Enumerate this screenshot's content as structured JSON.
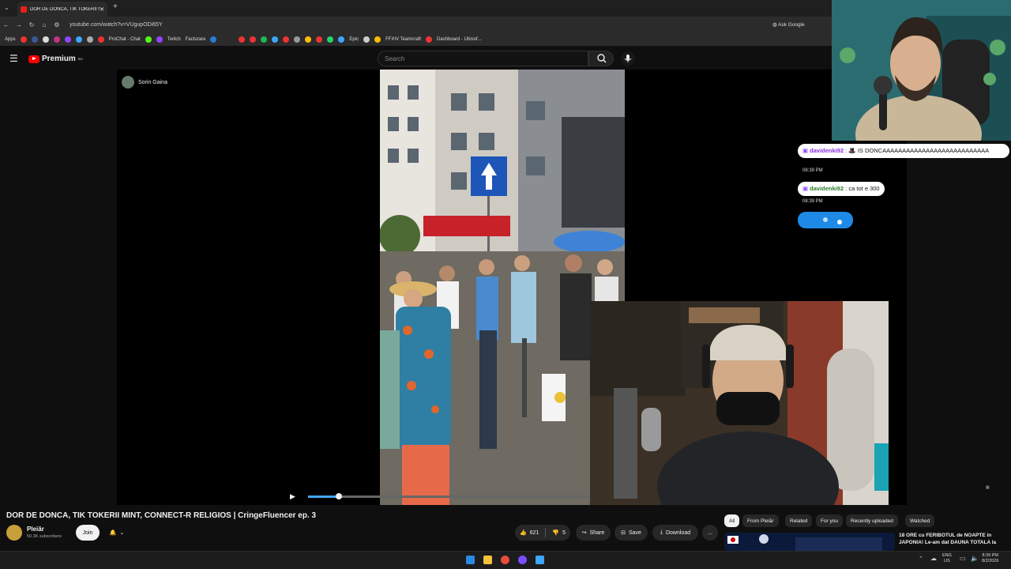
{
  "browser": {
    "tab_title": "DOR DE DONCA, TIK TOKERII M...",
    "url": "youtube.com/watch?v=VUgupODi65Y",
    "ask_google": "Ask Google",
    "bookmarks": [
      "Apps",
      "ProChat - Chat",
      "Twitch",
      "Facturare",
      "Epic",
      "FFXIV Teamcraft",
      "Dashboard - Ubisof..."
    ]
  },
  "youtube": {
    "logo_text": "Premium",
    "logo_badge": "RO",
    "search_placeholder": "Search",
    "video_overlay_channel": "Sorin Gaina",
    "video_title": "DOR DE DONCA, TIK TOKERII MINT, CONNECT-R RELIGIOS | CringeFluencer ep. 3",
    "channel_name": "Pleiăr",
    "subscribers": "50.3K subscribers",
    "join_label": "Join",
    "likes": "621",
    "dislikes": "5",
    "share_label": "Share",
    "save_label": "Save",
    "download_label": "Download",
    "more_label": "...",
    "progress": 0.11,
    "chips": [
      "All",
      "From Pleiăr",
      "Related",
      "For you",
      "Recently uploaded",
      "Watched"
    ],
    "rec_title_1": "18 ORE cu FERIBOTUL de NOAPTE in",
    "rec_title_2": "JAPONIA! Le-am dat DAUNA TOTALA la"
  },
  "chat": [
    {
      "user": "davidenki92",
      "text": "IS DONCAAAAAAAAAAAAAAAAAAAAAAAAAAA",
      "time": "08:39 PM"
    },
    {
      "user": "davidenki92",
      "text": "ca tot e 300",
      "time": "08:39 PM"
    }
  ],
  "taskbar": {
    "lang_1": "ENG",
    "lang_2": "US",
    "time": "8:39 PM",
    "date": "8/2/2026"
  },
  "colors": {
    "accent": "#3ea6ff",
    "yt_red": "#ff0000",
    "chat_bubble_typing": "#1e8ae6"
  }
}
